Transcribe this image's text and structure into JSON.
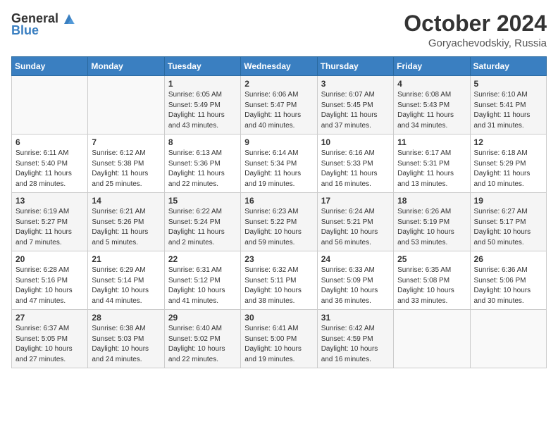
{
  "header": {
    "logo_general": "General",
    "logo_blue": "Blue",
    "month_title": "October 2024",
    "location": "Goryachevodskiy, Russia"
  },
  "weekdays": [
    "Sunday",
    "Monday",
    "Tuesday",
    "Wednesday",
    "Thursday",
    "Friday",
    "Saturday"
  ],
  "weeks": [
    [
      {
        "day": "",
        "info": ""
      },
      {
        "day": "",
        "info": ""
      },
      {
        "day": "1",
        "info": "Sunrise: 6:05 AM\nSunset: 5:49 PM\nDaylight: 11 hours and 43 minutes."
      },
      {
        "day": "2",
        "info": "Sunrise: 6:06 AM\nSunset: 5:47 PM\nDaylight: 11 hours and 40 minutes."
      },
      {
        "day": "3",
        "info": "Sunrise: 6:07 AM\nSunset: 5:45 PM\nDaylight: 11 hours and 37 minutes."
      },
      {
        "day": "4",
        "info": "Sunrise: 6:08 AM\nSunset: 5:43 PM\nDaylight: 11 hours and 34 minutes."
      },
      {
        "day": "5",
        "info": "Sunrise: 6:10 AM\nSunset: 5:41 PM\nDaylight: 11 hours and 31 minutes."
      }
    ],
    [
      {
        "day": "6",
        "info": "Sunrise: 6:11 AM\nSunset: 5:40 PM\nDaylight: 11 hours and 28 minutes."
      },
      {
        "day": "7",
        "info": "Sunrise: 6:12 AM\nSunset: 5:38 PM\nDaylight: 11 hours and 25 minutes."
      },
      {
        "day": "8",
        "info": "Sunrise: 6:13 AM\nSunset: 5:36 PM\nDaylight: 11 hours and 22 minutes."
      },
      {
        "day": "9",
        "info": "Sunrise: 6:14 AM\nSunset: 5:34 PM\nDaylight: 11 hours and 19 minutes."
      },
      {
        "day": "10",
        "info": "Sunrise: 6:16 AM\nSunset: 5:33 PM\nDaylight: 11 hours and 16 minutes."
      },
      {
        "day": "11",
        "info": "Sunrise: 6:17 AM\nSunset: 5:31 PM\nDaylight: 11 hours and 13 minutes."
      },
      {
        "day": "12",
        "info": "Sunrise: 6:18 AM\nSunset: 5:29 PM\nDaylight: 11 hours and 10 minutes."
      }
    ],
    [
      {
        "day": "13",
        "info": "Sunrise: 6:19 AM\nSunset: 5:27 PM\nDaylight: 11 hours and 7 minutes."
      },
      {
        "day": "14",
        "info": "Sunrise: 6:21 AM\nSunset: 5:26 PM\nDaylight: 11 hours and 5 minutes."
      },
      {
        "day": "15",
        "info": "Sunrise: 6:22 AM\nSunset: 5:24 PM\nDaylight: 11 hours and 2 minutes."
      },
      {
        "day": "16",
        "info": "Sunrise: 6:23 AM\nSunset: 5:22 PM\nDaylight: 10 hours and 59 minutes."
      },
      {
        "day": "17",
        "info": "Sunrise: 6:24 AM\nSunset: 5:21 PM\nDaylight: 10 hours and 56 minutes."
      },
      {
        "day": "18",
        "info": "Sunrise: 6:26 AM\nSunset: 5:19 PM\nDaylight: 10 hours and 53 minutes."
      },
      {
        "day": "19",
        "info": "Sunrise: 6:27 AM\nSunset: 5:17 PM\nDaylight: 10 hours and 50 minutes."
      }
    ],
    [
      {
        "day": "20",
        "info": "Sunrise: 6:28 AM\nSunset: 5:16 PM\nDaylight: 10 hours and 47 minutes."
      },
      {
        "day": "21",
        "info": "Sunrise: 6:29 AM\nSunset: 5:14 PM\nDaylight: 10 hours and 44 minutes."
      },
      {
        "day": "22",
        "info": "Sunrise: 6:31 AM\nSunset: 5:12 PM\nDaylight: 10 hours and 41 minutes."
      },
      {
        "day": "23",
        "info": "Sunrise: 6:32 AM\nSunset: 5:11 PM\nDaylight: 10 hours and 38 minutes."
      },
      {
        "day": "24",
        "info": "Sunrise: 6:33 AM\nSunset: 5:09 PM\nDaylight: 10 hours and 36 minutes."
      },
      {
        "day": "25",
        "info": "Sunrise: 6:35 AM\nSunset: 5:08 PM\nDaylight: 10 hours and 33 minutes."
      },
      {
        "day": "26",
        "info": "Sunrise: 6:36 AM\nSunset: 5:06 PM\nDaylight: 10 hours and 30 minutes."
      }
    ],
    [
      {
        "day": "27",
        "info": "Sunrise: 6:37 AM\nSunset: 5:05 PM\nDaylight: 10 hours and 27 minutes."
      },
      {
        "day": "28",
        "info": "Sunrise: 6:38 AM\nSunset: 5:03 PM\nDaylight: 10 hours and 24 minutes."
      },
      {
        "day": "29",
        "info": "Sunrise: 6:40 AM\nSunset: 5:02 PM\nDaylight: 10 hours and 22 minutes."
      },
      {
        "day": "30",
        "info": "Sunrise: 6:41 AM\nSunset: 5:00 PM\nDaylight: 10 hours and 19 minutes."
      },
      {
        "day": "31",
        "info": "Sunrise: 6:42 AM\nSunset: 4:59 PM\nDaylight: 10 hours and 16 minutes."
      },
      {
        "day": "",
        "info": ""
      },
      {
        "day": "",
        "info": ""
      }
    ]
  ]
}
